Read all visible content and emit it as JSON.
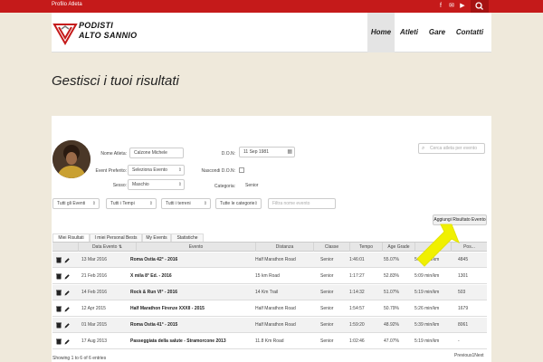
{
  "topbar": {
    "profile_label": "Profilo Atleta",
    "social_icons": [
      "facebook-icon",
      "email-icon",
      "youtube-icon"
    ],
    "search_icon": "search-icon"
  },
  "navbar": {
    "brand_line1": "PODISTI",
    "brand_line2": "ALTO SANNIO",
    "items": [
      {
        "label": "Home",
        "active": true
      },
      {
        "label": "Atleti",
        "active": false
      },
      {
        "label": "Gare",
        "active": false
      },
      {
        "label": "Contatti",
        "active": false
      }
    ]
  },
  "banner": {
    "title": "Gestisci i tuoi risultati"
  },
  "form": {
    "name_label": "Nome Atleta:",
    "name_value": "Calzone Michele",
    "event_label": "Event Preferito:",
    "event_value": "Seleziona Evento",
    "sex_label": "Sesso:",
    "sex_value": "Maschio",
    "dob_label": "D.O.N:",
    "dob_value": "11 Sep 1981",
    "hide_dob_label": "Nascondi D.O.N:",
    "category_label": "Categoria:",
    "category_value": "Senior",
    "search_placeholder": "Cerca atleta per evento"
  },
  "filters": {
    "events": "Tutti gli Eventi",
    "times": "Tutti i Tempi",
    "terrains": "Tutti i terreni",
    "categories": "Tutte le categorie",
    "search_placeholder": "Filtra nome evento"
  },
  "add_button": "Aggiungi Risultato Evento",
  "tabs": [
    "Miei Risultati",
    "I miei Personal Bests",
    "My Events",
    "Statistiche"
  ],
  "table": {
    "headers": [
      "Data Evento",
      "Evento",
      "Distanza",
      "Classe",
      "Tempo",
      "Age Grade",
      "",
      "Pos..."
    ],
    "rows": [
      {
        "date": "13 Mar 2016",
        "event": "Roma Ostia 42° - 2016",
        "distance": "Half Marathon Road",
        "class": "Senior",
        "time": "1:46:01",
        "age_grade": "55.07%",
        "pace": "5:09 min/km",
        "pos": "4845"
      },
      {
        "date": "21 Feb 2016",
        "event": "X mila 8° Ed. - 2016",
        "distance": "15 km Road",
        "class": "Senior",
        "time": "1:17:27",
        "age_grade": "52.83%",
        "pace": "5:09 min/km",
        "pos": "1301"
      },
      {
        "date": "14 Feb 2016",
        "event": "Rock & Run VI° - 2016",
        "distance": "14 Km Trail",
        "class": "Senior",
        "time": "1:14:32",
        "age_grade": "51.07%",
        "pace": "5:19 min/km",
        "pos": "503"
      },
      {
        "date": "12 Apr 2015",
        "event": "Half Marathon Firenze XXXII - 2015",
        "distance": "Half Marathon Road",
        "class": "Senior",
        "time": "1:54:57",
        "age_grade": "50.79%",
        "pace": "5:26 min/km",
        "pos": "1679"
      },
      {
        "date": "01 Mar 2015",
        "event": "Roma Ostia 41° - 2015",
        "distance": "Half Marathon Road",
        "class": "Senior",
        "time": "1:59:20",
        "age_grade": "48.92%",
        "pace": "5:39 min/km",
        "pos": "8061"
      },
      {
        "date": "17 Aug 2013",
        "event": "Passeggiata della salute - Stramorcone 2013",
        "distance": "11.8 Km Road",
        "class": "Senior",
        "time": "1:02:46",
        "age_grade": "47.07%",
        "pace": "5:19 min/km",
        "pos": "-"
      }
    ]
  },
  "footer": {
    "showing": "Showing 1 to 6 of 6 entries",
    "pagination": "Previous1Next"
  },
  "colors": {
    "brand_red": "#c51a1a",
    "highlight_arrow": "#f0f000",
    "background": "#efe9db"
  }
}
